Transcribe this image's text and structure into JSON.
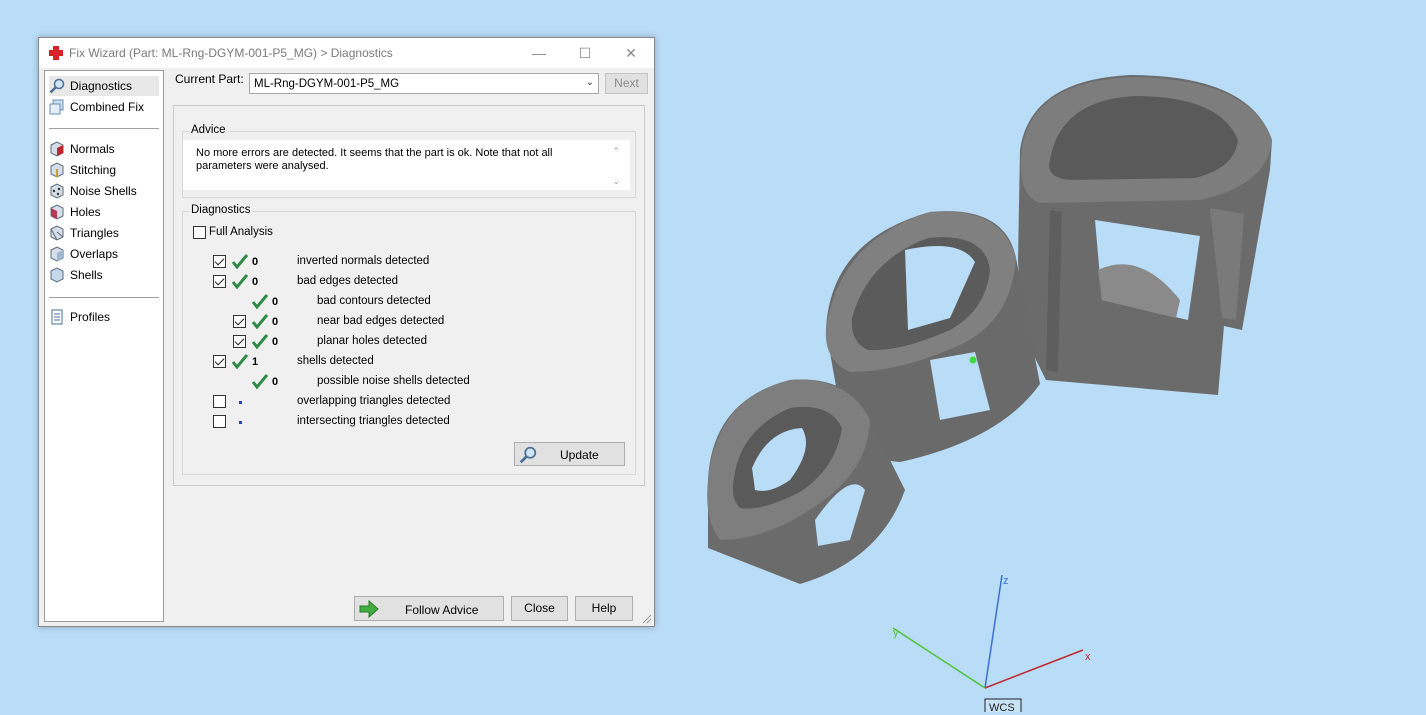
{
  "window": {
    "title": "Fix Wizard (Part: ML-Rng-DGYM-001-P5_MG) > Diagnostics",
    "minimize": "—",
    "maximize": "☐",
    "close": "✕"
  },
  "sidebar": {
    "items": [
      {
        "label": "Diagnostics",
        "icon": "magnifier-icon"
      },
      {
        "label": "Combined Fix",
        "icon": "combined-fix-icon"
      },
      {
        "label": "Normals",
        "icon": "normals-cube-icon"
      },
      {
        "label": "Stitching",
        "icon": "stitching-cube-icon"
      },
      {
        "label": "Noise Shells",
        "icon": "noise-shells-cube-icon"
      },
      {
        "label": "Holes",
        "icon": "holes-cube-icon"
      },
      {
        "label": "Triangles",
        "icon": "triangles-cube-icon"
      },
      {
        "label": "Overlaps",
        "icon": "overlaps-cube-icon"
      },
      {
        "label": "Shells",
        "icon": "shells-cube-icon"
      },
      {
        "label": "Profiles",
        "icon": "document-icon"
      }
    ]
  },
  "current_part": {
    "label": "Current Part:",
    "value": "ML-Rng-DGYM-001-P5_MG",
    "next_label": "Next"
  },
  "advice": {
    "title": "Advice",
    "text": "No more errors are detected. It seems that the part is ok. Note that not all parameters were analysed."
  },
  "diagnostics": {
    "title": "Diagnostics",
    "full_analysis_label": "Full Analysis",
    "rows": [
      {
        "value": "0",
        "label": "inverted normals detected"
      },
      {
        "value": "0",
        "label": "bad edges detected"
      },
      {
        "value": "0",
        "label": "bad contours detected"
      },
      {
        "value": "0",
        "label": "near bad edges detected"
      },
      {
        "value": "0",
        "label": "planar holes detected"
      },
      {
        "value": "1",
        "label": "shells detected"
      },
      {
        "value": "0",
        "label": "possible noise shells detected"
      },
      {
        "value": "",
        "label": "overlapping triangles detected"
      },
      {
        "value": "",
        "label": "intersecting triangles detected"
      }
    ],
    "update_label": "Update"
  },
  "footer": {
    "follow_advice": "Follow Advice",
    "close": "Close",
    "help": "Help"
  },
  "viewport": {
    "axes": {
      "x": "x",
      "y": "y",
      "z": "z",
      "wcs": "WCS"
    },
    "colors": {
      "background": "#b9dcf7",
      "x_axis": "#c0272d",
      "y_axis": "#4fc43a",
      "z_axis": "#3b6fd1"
    }
  }
}
